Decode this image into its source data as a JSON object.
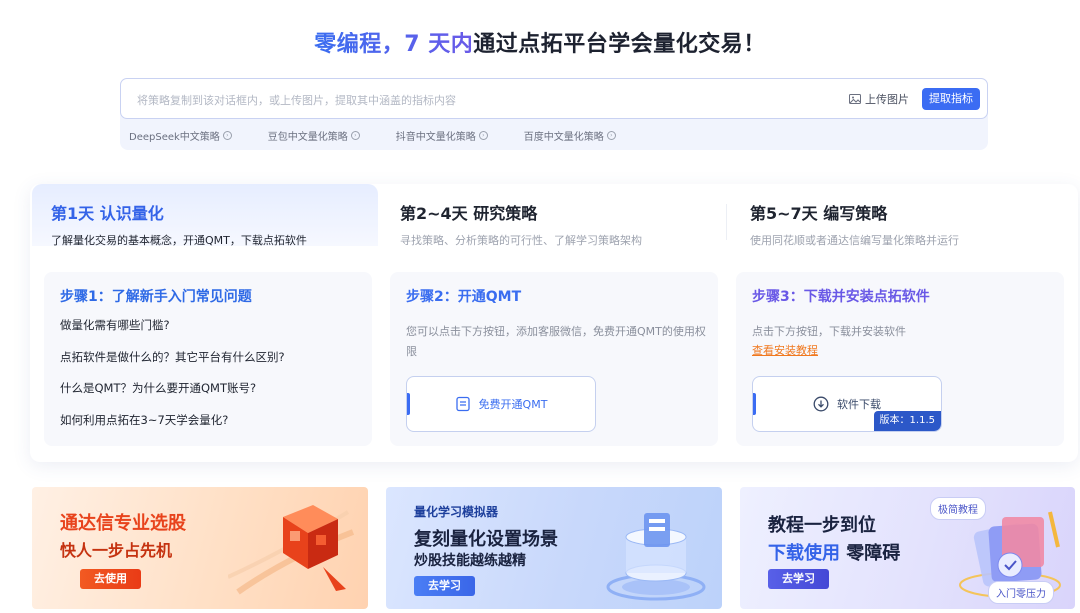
{
  "hero": {
    "highlight": "零编程，7 天内",
    "rest": "通过点拓平台学会量化交易！"
  },
  "search": {
    "placeholder": "将策略复制到该对话框内，或上传图片，提取其中涵盖的指标内容",
    "upload_label": "上传图片",
    "extract_label": "提取指标",
    "quick_links": [
      "DeepSeek中文策略",
      "豆包中文量化策略",
      "抖音中文量化策略",
      "百度中文量化策略"
    ]
  },
  "days": [
    {
      "title": "第1天 认识量化",
      "desc": "了解量化交易的基本概念，开通QMT，下载点拓软件",
      "active": true
    },
    {
      "title": "第2~4天 研究策略",
      "desc": "寻找策略、分析策略的可行性、了解学习策略架构",
      "active": false
    },
    {
      "title": "第5~7天 编写策略",
      "desc": "使用同花顺或者通达信编写量化策略并运行",
      "active": false
    }
  ],
  "steps": {
    "step1": {
      "title": "步骤1：了解新手入门常见问题",
      "faqs": [
        "做量化需有哪些门槛?",
        "点拓软件是做什么的？其它平台有什么区别?",
        "什么是QMT？为什么要开通QMT账号?",
        "如何利用点拓在3~7天学会量化?"
      ]
    },
    "step2": {
      "title": "步骤2：开通QMT",
      "desc": "您可以点击下方按钮，添加客服微信，免费开通QMT的使用权限",
      "button": "免费开通QMT"
    },
    "step3": {
      "title": "步骤3：下载并安装点拓软件",
      "desc": "点击下方按钮，下载并安装软件",
      "link": "查看安装教程",
      "button": "软件下载",
      "version": "版本：1.1.5"
    }
  },
  "banners": {
    "b1": {
      "line1": "通达信专业选股",
      "line2": "快人一步占先机",
      "cta": "去使用"
    },
    "b2": {
      "tag": "量化学习模拟器",
      "line1": "复刻量化设置场景",
      "line2": "炒股技能越练越精",
      "cta": "去学习"
    },
    "b3": {
      "line1": "教程一步到位",
      "line2_highlight": "下载使用",
      "line2_rest": " 零障碍",
      "cta": "去学习",
      "chip1": "极简教程",
      "chip2": "入门零压力"
    }
  },
  "colors": {
    "primary": "#3b6cf3",
    "purple": "#6958e6",
    "orange_link": "#f0781e",
    "banner_orange": "#e8431c"
  }
}
